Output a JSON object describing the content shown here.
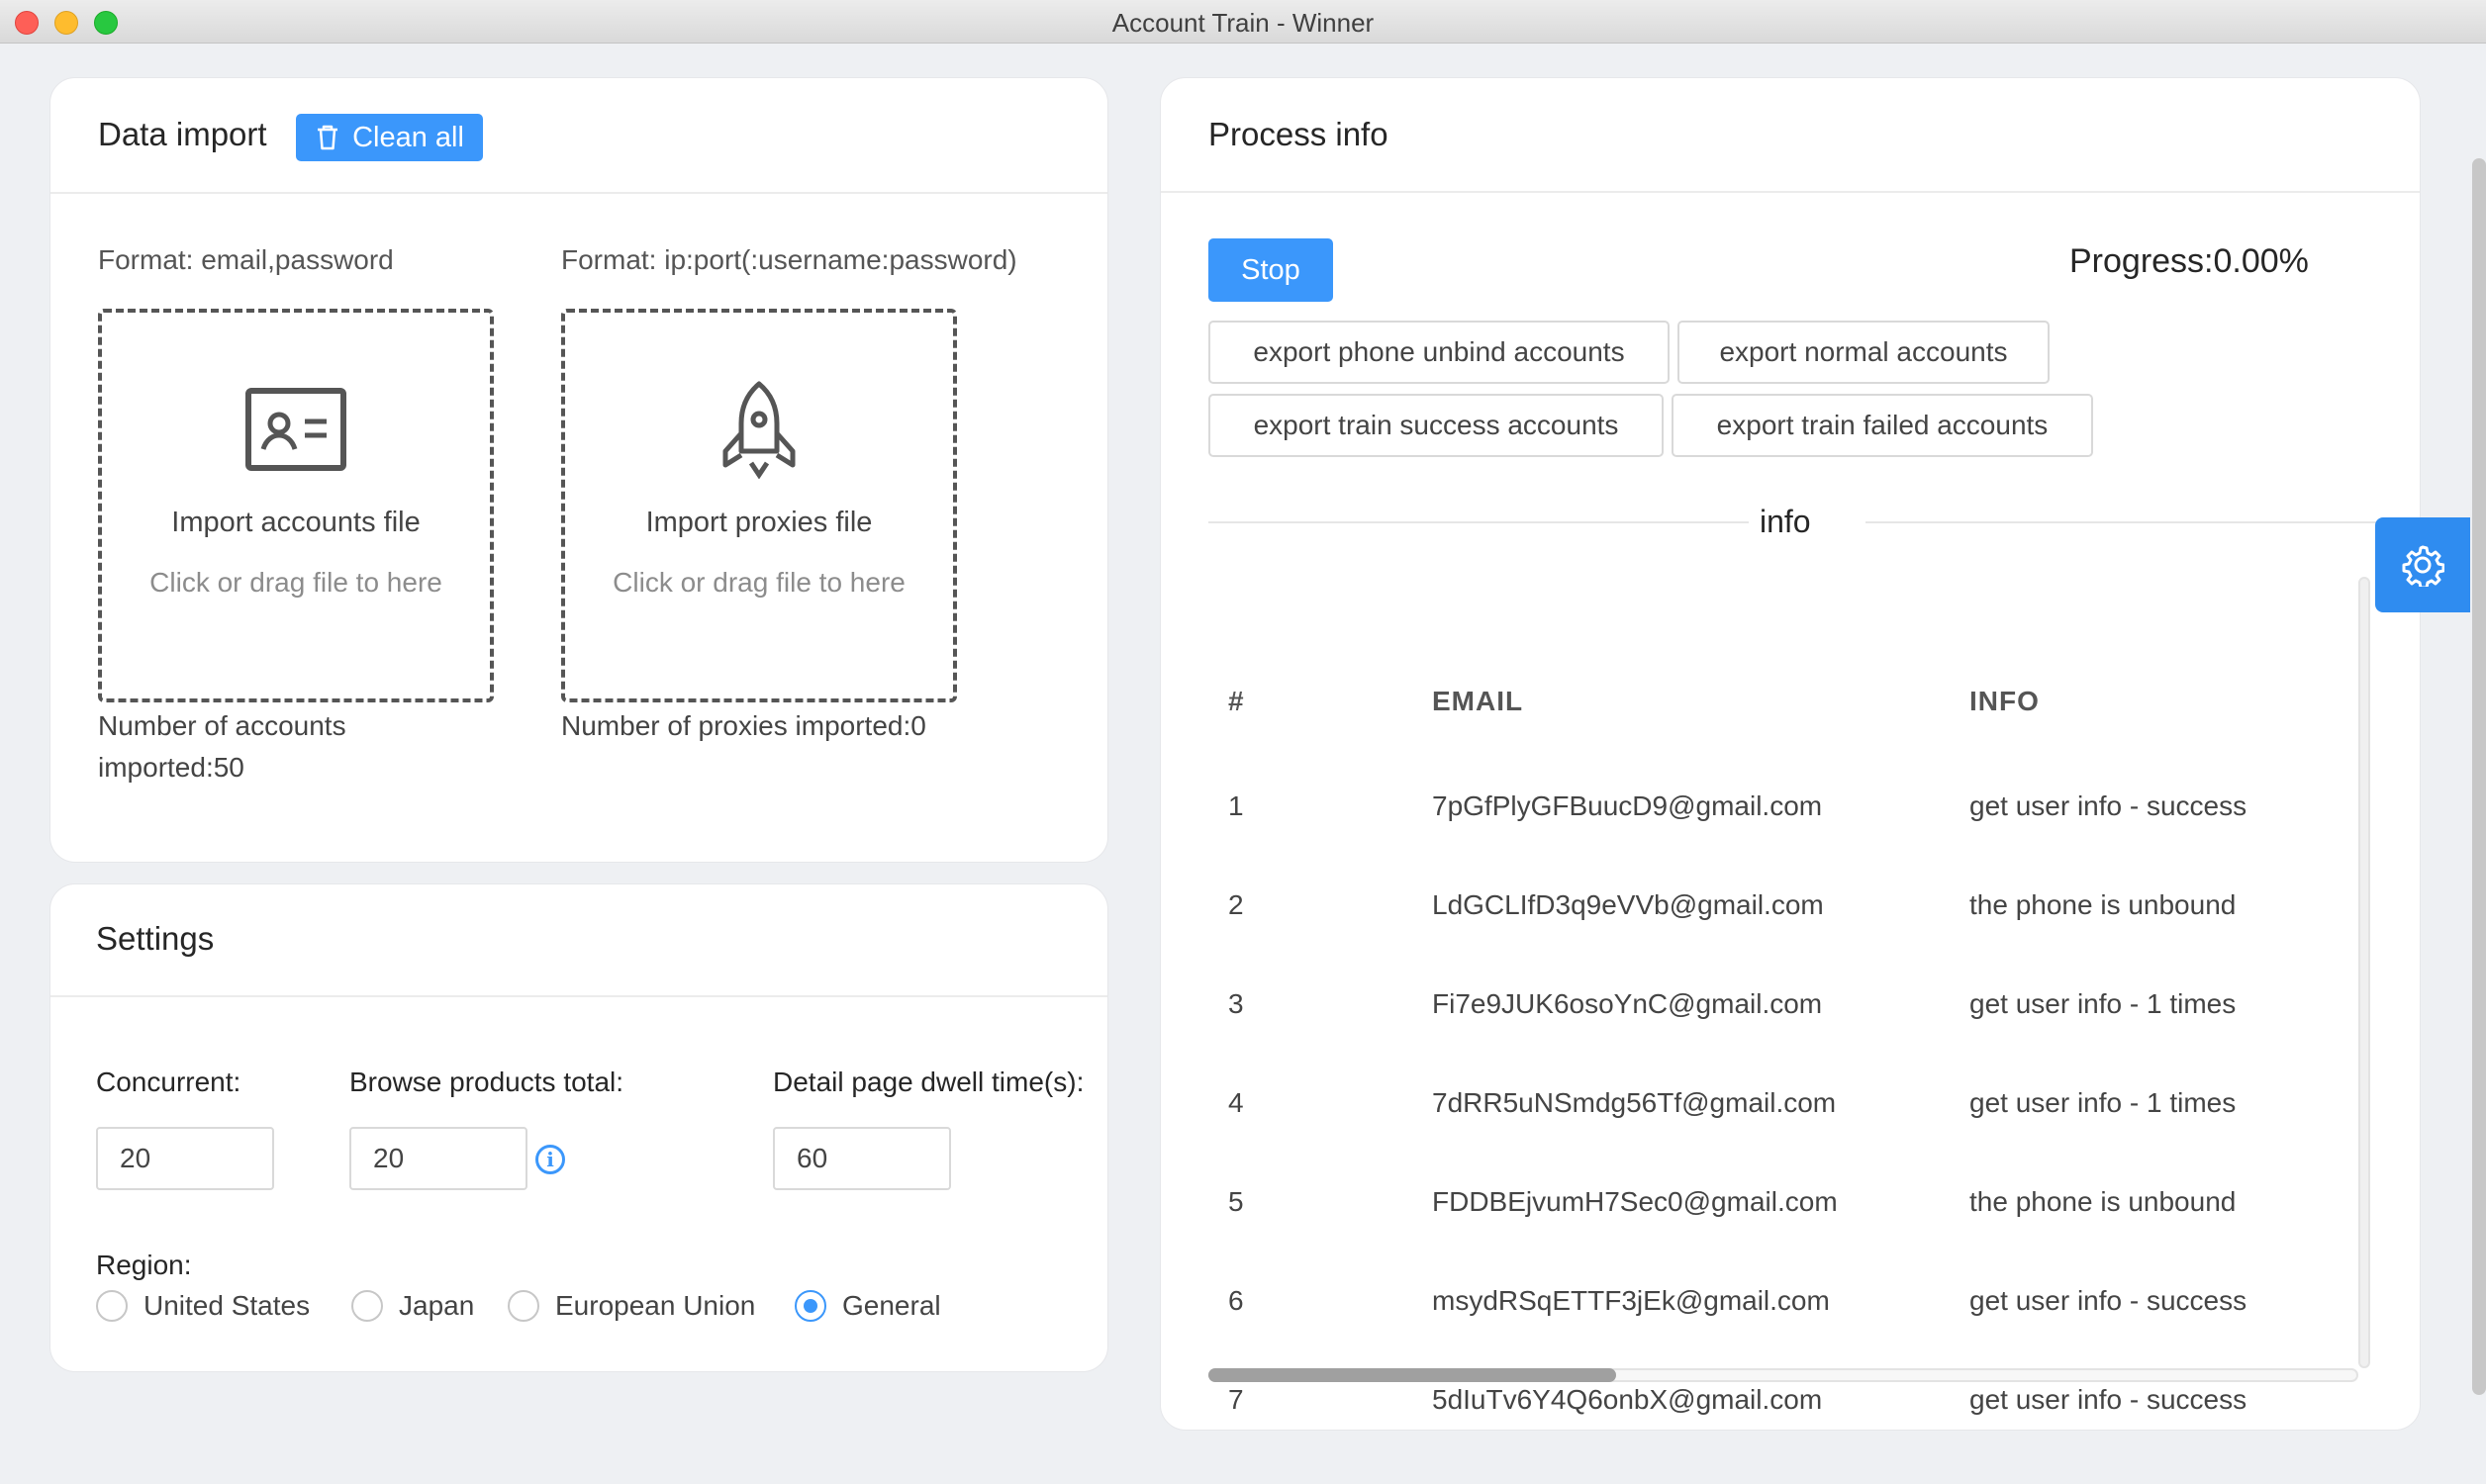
{
  "window": {
    "title": "Account Train - Winner"
  },
  "data_import": {
    "title": "Data import",
    "clean_all_label": "Clean all",
    "accounts": {
      "format": "Format: email,password",
      "title": "Import accounts file",
      "hint": "Click or drag file to here",
      "count_line1": "Number of accounts",
      "count_line2": "imported:50"
    },
    "proxies": {
      "format": "Format: ip:port(:username:password)",
      "title": "Import proxies file",
      "hint": "Click or drag file to here",
      "count": "Number of proxies imported:0"
    }
  },
  "settings": {
    "title": "Settings",
    "concurrent": {
      "label": "Concurrent",
      "value": "20"
    },
    "browse_total": {
      "label": "Browse products total",
      "value": "20"
    },
    "dwell_time": {
      "label": "Detail page dwell time(s)",
      "value": "60"
    },
    "colon": ":",
    "region": {
      "label": "Region:",
      "options": [
        "United States",
        "Japan",
        "European Union",
        "General"
      ],
      "selected": "General"
    }
  },
  "process": {
    "title": "Process info",
    "stop_label": "Stop",
    "progress_text": "Progress:0.00%",
    "progress_value": 0.0,
    "export_buttons": [
      "export phone unbind accounts",
      "export normal accounts",
      "export train success accounts",
      "export train failed accounts"
    ],
    "divider_label": "info",
    "table": {
      "headers": [
        "#",
        "EMAIL",
        "INFO"
      ],
      "rows": [
        [
          "1",
          "7pGfPlyGFBuucD9@gmail.com",
          "get user info - success"
        ],
        [
          "2",
          "LdGCLIfD3q9eVVb@gmail.com",
          "the phone is unbound"
        ],
        [
          "3",
          "Fi7e9JUK6osoYnC@gmail.com",
          "get user info - 1 times"
        ],
        [
          "4",
          "7dRR5uNSmdg56Tf@gmail.com",
          "get user info - 1 times"
        ],
        [
          "5",
          "FDDBEjvumH7Sec0@gmail.com",
          "the phone is unbound"
        ],
        [
          "6",
          "msydRSqETTF3jEk@gmail.com",
          "get user info - success"
        ],
        [
          "7",
          "5dIuTv6Y4Q6onbX@gmail.com",
          "get user info - success"
        ]
      ]
    }
  },
  "icons": {
    "trash": "trash-icon",
    "id_card": "id-card-icon",
    "rocket": "rocket-icon",
    "info": "info-circle-icon",
    "gear": "gear-icon"
  },
  "colors": {
    "primary": "#3b97fb",
    "gear_bg": "#2f8cf0"
  }
}
